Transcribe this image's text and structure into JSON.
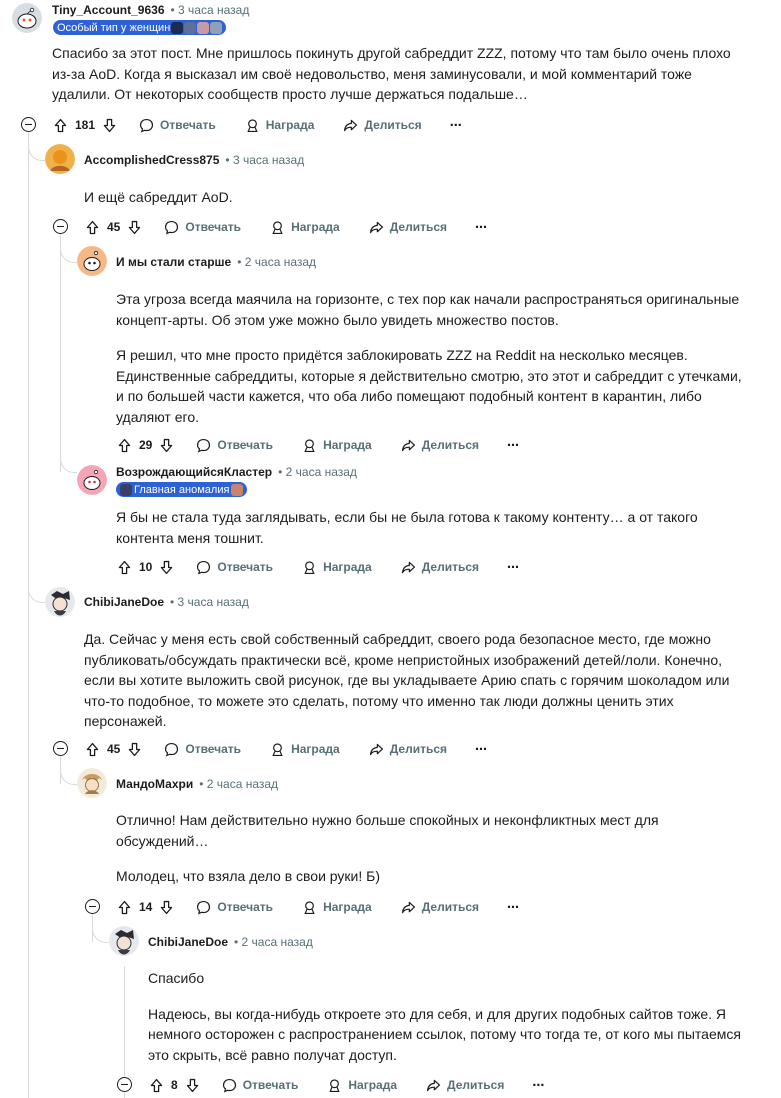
{
  "comments": [
    {
      "username": "Tiny_Account_9636",
      "time": "• 3 часа назад",
      "flair": "Особый тип у женщин",
      "paragraphs": [
        "Спасибо за этот пост. Мне пришлось покинуть другой сабреддит ZZZ, потому что там было очень плохо из-за AoD. Когда я высказал им своё недовольство, меня заминусовали, и мой комментарий тоже удалили. От некоторых сообществ просто лучше держаться подальше…"
      ],
      "votes": "181",
      "reply": "Отвечать",
      "award": "Награда",
      "share": "Делиться",
      "more": "⋯"
    },
    {
      "username": "AccomplishedCress875",
      "time": "• 3 часа назад",
      "paragraphs": [
        "И ещё сабреддит AoD."
      ],
      "votes": "45",
      "reply": "Отвечать",
      "award": "Награда",
      "share": "Делиться",
      "more": "⋯"
    },
    {
      "username": "И мы стали старше",
      "time": "• 2 часа назад",
      "paragraphs": [
        "Эта угроза всегда маячила на горизонте, с тех пор как начали распространяться оригинальные концепт-арты. Об этом уже можно было увидеть множество постов.",
        "Я решил, что мне просто придётся заблокировать ZZZ на Reddit на несколько месяцев. Единственные сабреддиты, которые я действительно смотрю, это этот и сабреддит с утечками, и по большей части кажется, что оба либо помещают подобный контент в карантин, либо удаляют его."
      ],
      "votes": "29",
      "reply": "Отвечать",
      "award": "Награда",
      "share": "Делиться",
      "more": "⋯"
    },
    {
      "username": "ВозрождающийсяКластер",
      "time": "• 2 часа назад",
      "flair": "Главная аномалия",
      "paragraphs": [
        "Я бы не стала туда заглядывать, если бы не была готова к такому контенту… а от такого контента меня тошнит."
      ],
      "votes": "10",
      "reply": "Отвечать",
      "award": "Награда",
      "share": "Делиться",
      "more": "⋯"
    },
    {
      "username": "ChibiJaneDoe",
      "time": "• 3 часа назад",
      "paragraphs": [
        "Да. Сейчас у меня есть свой собственный сабреддит, своего рода безопасное место, где можно публиковать/обсуждать практически всё, кроме непристойных изображений детей/лоли. Конечно, если вы хотите выложить свой рисунок, где вы укладываете Арию спать с горячим шоколадом или что-то подобное, то можете это сделать, потому что именно так люди должны ценить этих персонажей."
      ],
      "votes": "45",
      "reply": "Отвечать",
      "award": "Награда",
      "share": "Делиться",
      "more": "⋯"
    },
    {
      "username": "МандоМахри",
      "time": "• 2 часа назад",
      "paragraphs": [
        "Отлично! Нам действительно нужно больше спокойных и неконфликтных мест для обсуждений…",
        "Молодец, что взяла дело в свои руки! Б)"
      ],
      "votes": "14",
      "reply": "Отвечать",
      "award": "Награда",
      "share": "Делиться",
      "more": "⋯"
    },
    {
      "username": "ChibiJaneDoe",
      "time": "• 2 часа назад",
      "paragraphs": [
        "Спасибо",
        "Надеюсь, вы когда-нибудь откроете это для себя, и для других подобных сайтов тоже. Я немного осторожен с распространением ссылок, потому что тогда те, от кого мы пытаемся это скрыть, всё равно получат доступ."
      ],
      "votes": "8",
      "reply": "Отвечать",
      "award": "Награда",
      "share": "Делиться",
      "more": "⋯"
    }
  ],
  "colors": {
    "flair_bg": "#2d61d6",
    "meta_text": "#576f76",
    "thread_line": "#d7dadc"
  }
}
